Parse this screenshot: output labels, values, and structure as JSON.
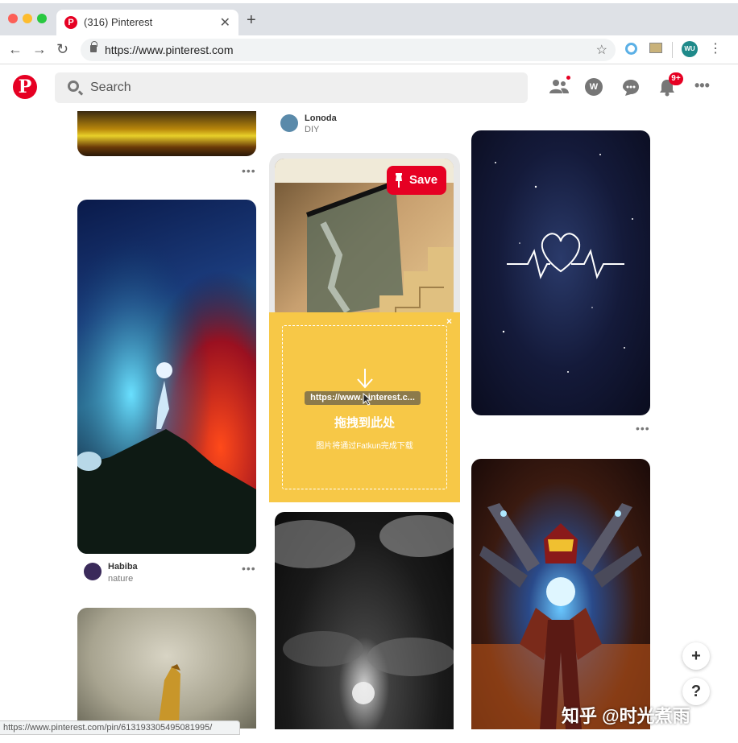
{
  "browser": {
    "tab_title": "(316) Pinterest",
    "url": "https://www.pinterest.com",
    "new_tab_label": "+",
    "tab_close_label": "✕",
    "account_initials": "WU"
  },
  "header": {
    "search_placeholder": "Search",
    "notification_count": "9+",
    "profile_initial": "W"
  },
  "pins": [
    {
      "id": "pin-fantasy-forest",
      "user": "",
      "board": ""
    },
    {
      "id": "pin-stairs",
      "user": "Lonoda",
      "board": "DIY"
    },
    {
      "id": "pin-heartbeat-galaxy",
      "user": "",
      "board": ""
    },
    {
      "id": "pin-mountain-moon",
      "user": "Habiba",
      "board": "nature"
    },
    {
      "id": "pin-dark-clouds",
      "user": "",
      "board": ""
    },
    {
      "id": "pin-iron-man",
      "user": "",
      "board": ""
    },
    {
      "id": "pin-golden-bird",
      "user": "",
      "board": ""
    }
  ],
  "save_button": {
    "label": "Save"
  },
  "pin_more_label": "•••",
  "dropzone": {
    "url_chip": "https://www.pinterest.c...",
    "title": "拖拽到此处",
    "subtitle": "图片将通过Fatkun完成下载",
    "close_label": "×"
  },
  "floating": {
    "add_label": "+",
    "help_label": "?"
  },
  "status_url": "https://www.pinterest.com/pin/613193305495081995/",
  "watermark": "知乎 @时光煮雨",
  "colors": {
    "brand": "#e60023",
    "dropzone": "#f7c847"
  }
}
